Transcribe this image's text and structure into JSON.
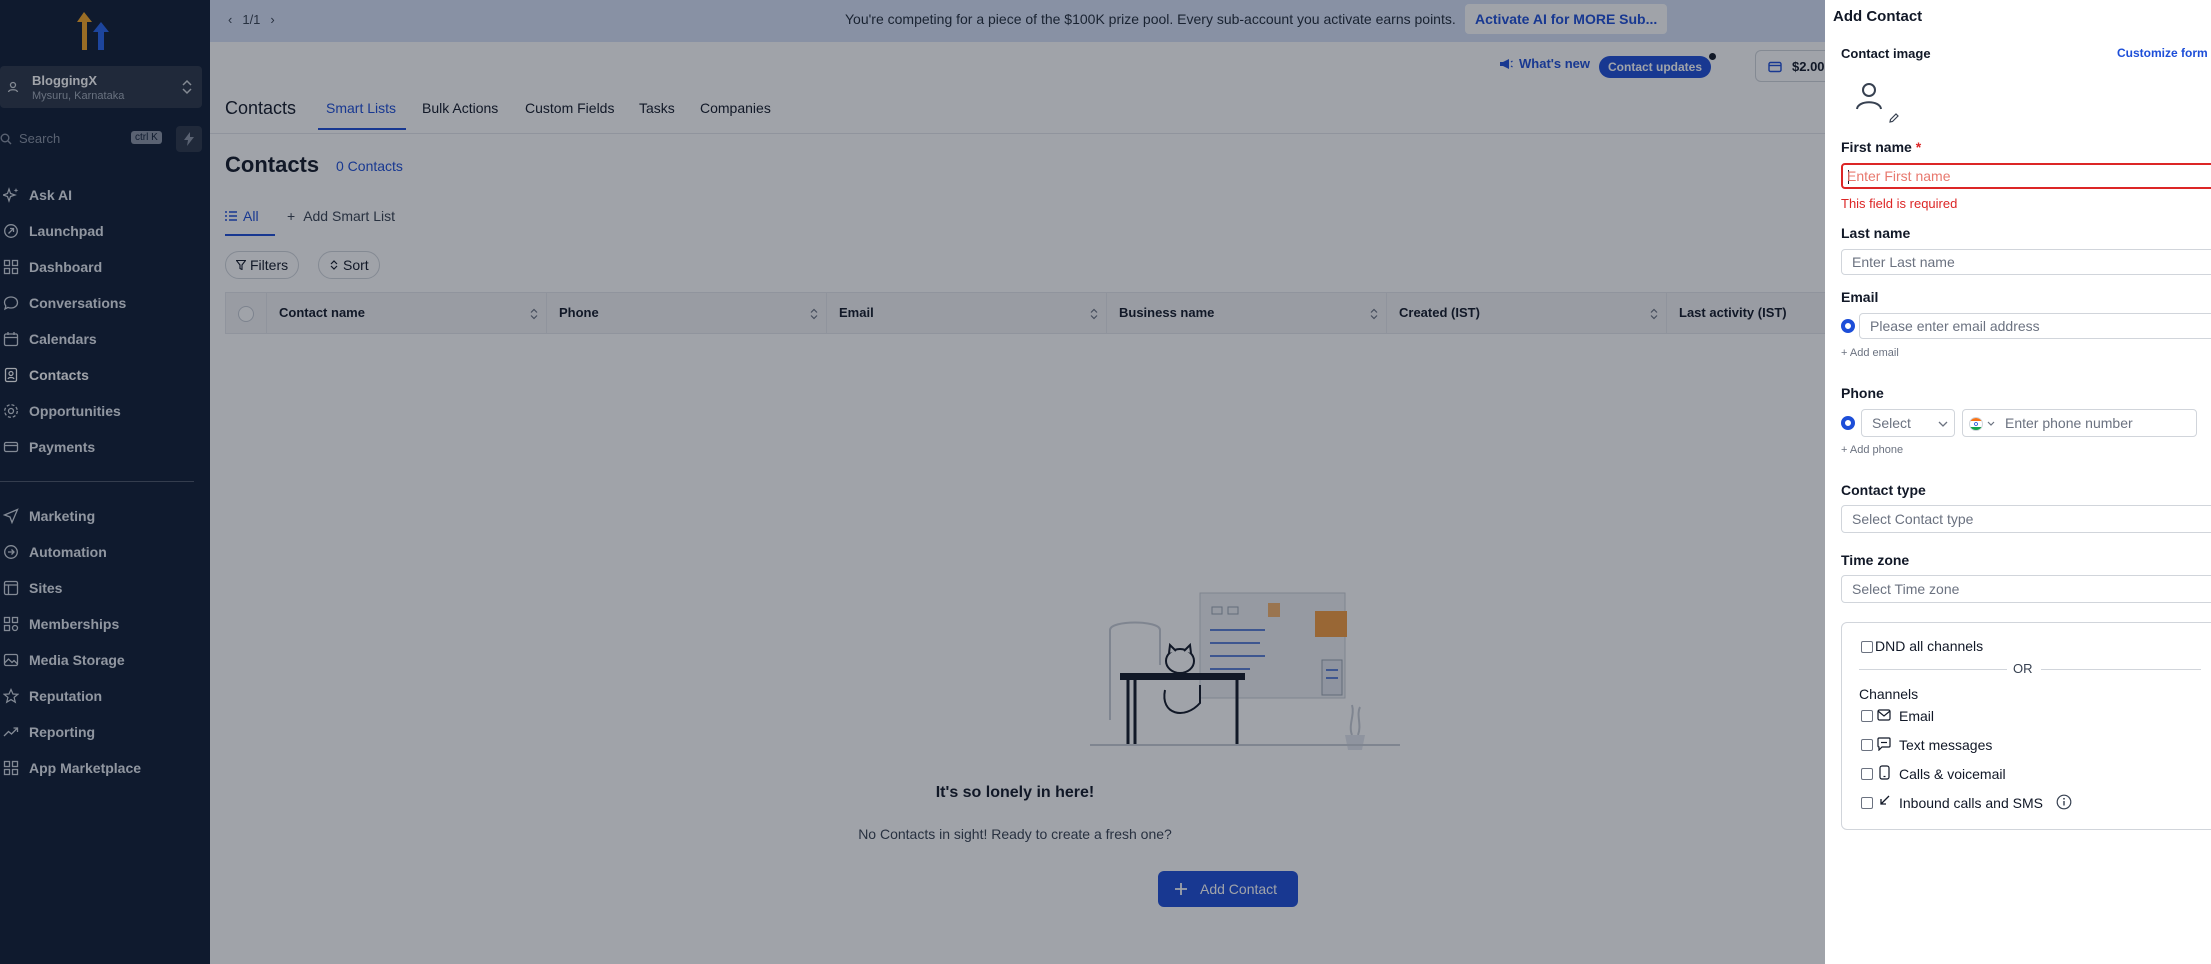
{
  "sidebar": {
    "account_name": "BloggingX",
    "account_location": "Mysuru, Karnataka",
    "search_placeholder": "Search",
    "search_shortcut": "ctrl K",
    "nav_items": [
      {
        "label": "Ask AI",
        "icon": "sparkle-icon"
      },
      {
        "label": "Launchpad",
        "icon": "rocket-icon"
      },
      {
        "label": "Dashboard",
        "icon": "grid-icon"
      },
      {
        "label": "Conversations",
        "icon": "chat-icon"
      },
      {
        "label": "Calendars",
        "icon": "calendar-icon"
      },
      {
        "label": "Contacts",
        "icon": "contacts-icon"
      },
      {
        "label": "Opportunities",
        "icon": "funnel-icon"
      },
      {
        "label": "Payments",
        "icon": "payment-icon"
      },
      {
        "label": "Marketing",
        "icon": "send-icon"
      },
      {
        "label": "Automation",
        "icon": "automation-icon"
      },
      {
        "label": "Sites",
        "icon": "sites-icon"
      },
      {
        "label": "Memberships",
        "icon": "memberships-icon"
      },
      {
        "label": "Media Storage",
        "icon": "image-icon"
      },
      {
        "label": "Reputation",
        "icon": "star-icon"
      },
      {
        "label": "Reporting",
        "icon": "trend-icon"
      },
      {
        "label": "App Marketplace",
        "icon": "apps-icon"
      }
    ]
  },
  "banner": {
    "pager": "1/1",
    "message": "You're competing for a piece of the $100K prize pool. Every sub-account you activate earns points.",
    "action_label": "Activate AI for MORE Sub..."
  },
  "topbar": {
    "whats_new": "What's new",
    "contact_updates": "Contact updates",
    "wallet_amount": "$2.00"
  },
  "tabs": {
    "section_title": "Contacts",
    "items": [
      "Smart Lists",
      "Bulk Actions",
      "Custom Fields",
      "Tasks",
      "Companies"
    ],
    "active": "Smart Lists"
  },
  "page": {
    "title": "Contacts",
    "count": "0 Contacts",
    "smart_list_all": "All",
    "add_smart_list": "Add Smart List",
    "filters": "Filters",
    "sort": "Sort",
    "columns": [
      "Contact name",
      "Phone",
      "Email",
      "Business name",
      "Created (IST)",
      "Last activity (IST)"
    ],
    "empty_title": "It's so lonely in here!",
    "empty_subtitle": "No Contacts in sight! Ready to create a fresh one?",
    "add_contact_button": "Add Contact"
  },
  "drawer": {
    "title": "Add Contact",
    "contact_image_label": "Contact image",
    "customize_form": "Customize form",
    "first_name_label": "First name",
    "required_mark": "*",
    "first_name_placeholder": "Enter First name",
    "first_name_error": "This field is required",
    "last_name_label": "Last name",
    "last_name_placeholder": "Enter Last name",
    "email_label": "Email",
    "email_placeholder": "Please enter email address",
    "add_email": "+ Add email",
    "phone_label": "Phone",
    "phone_type_placeholder": "Select",
    "phone_placeholder": "Enter phone number",
    "add_phone": "+ Add phone",
    "contact_type_label": "Contact type",
    "contact_type_placeholder": "Select Contact type",
    "time_zone_label": "Time zone",
    "time_zone_placeholder": "Select Time zone",
    "dnd_all": "DND all channels",
    "or_text": "OR",
    "channels_label": "Channels",
    "channels": [
      "Email",
      "Text messages",
      "Calls & voicemail",
      "Inbound calls and SMS"
    ]
  },
  "colors": {
    "sidebar_bg": "#0e1c33",
    "primary": "#1d4ed8",
    "error": "#dc2626",
    "banner_bg": "#d7e2f7"
  }
}
